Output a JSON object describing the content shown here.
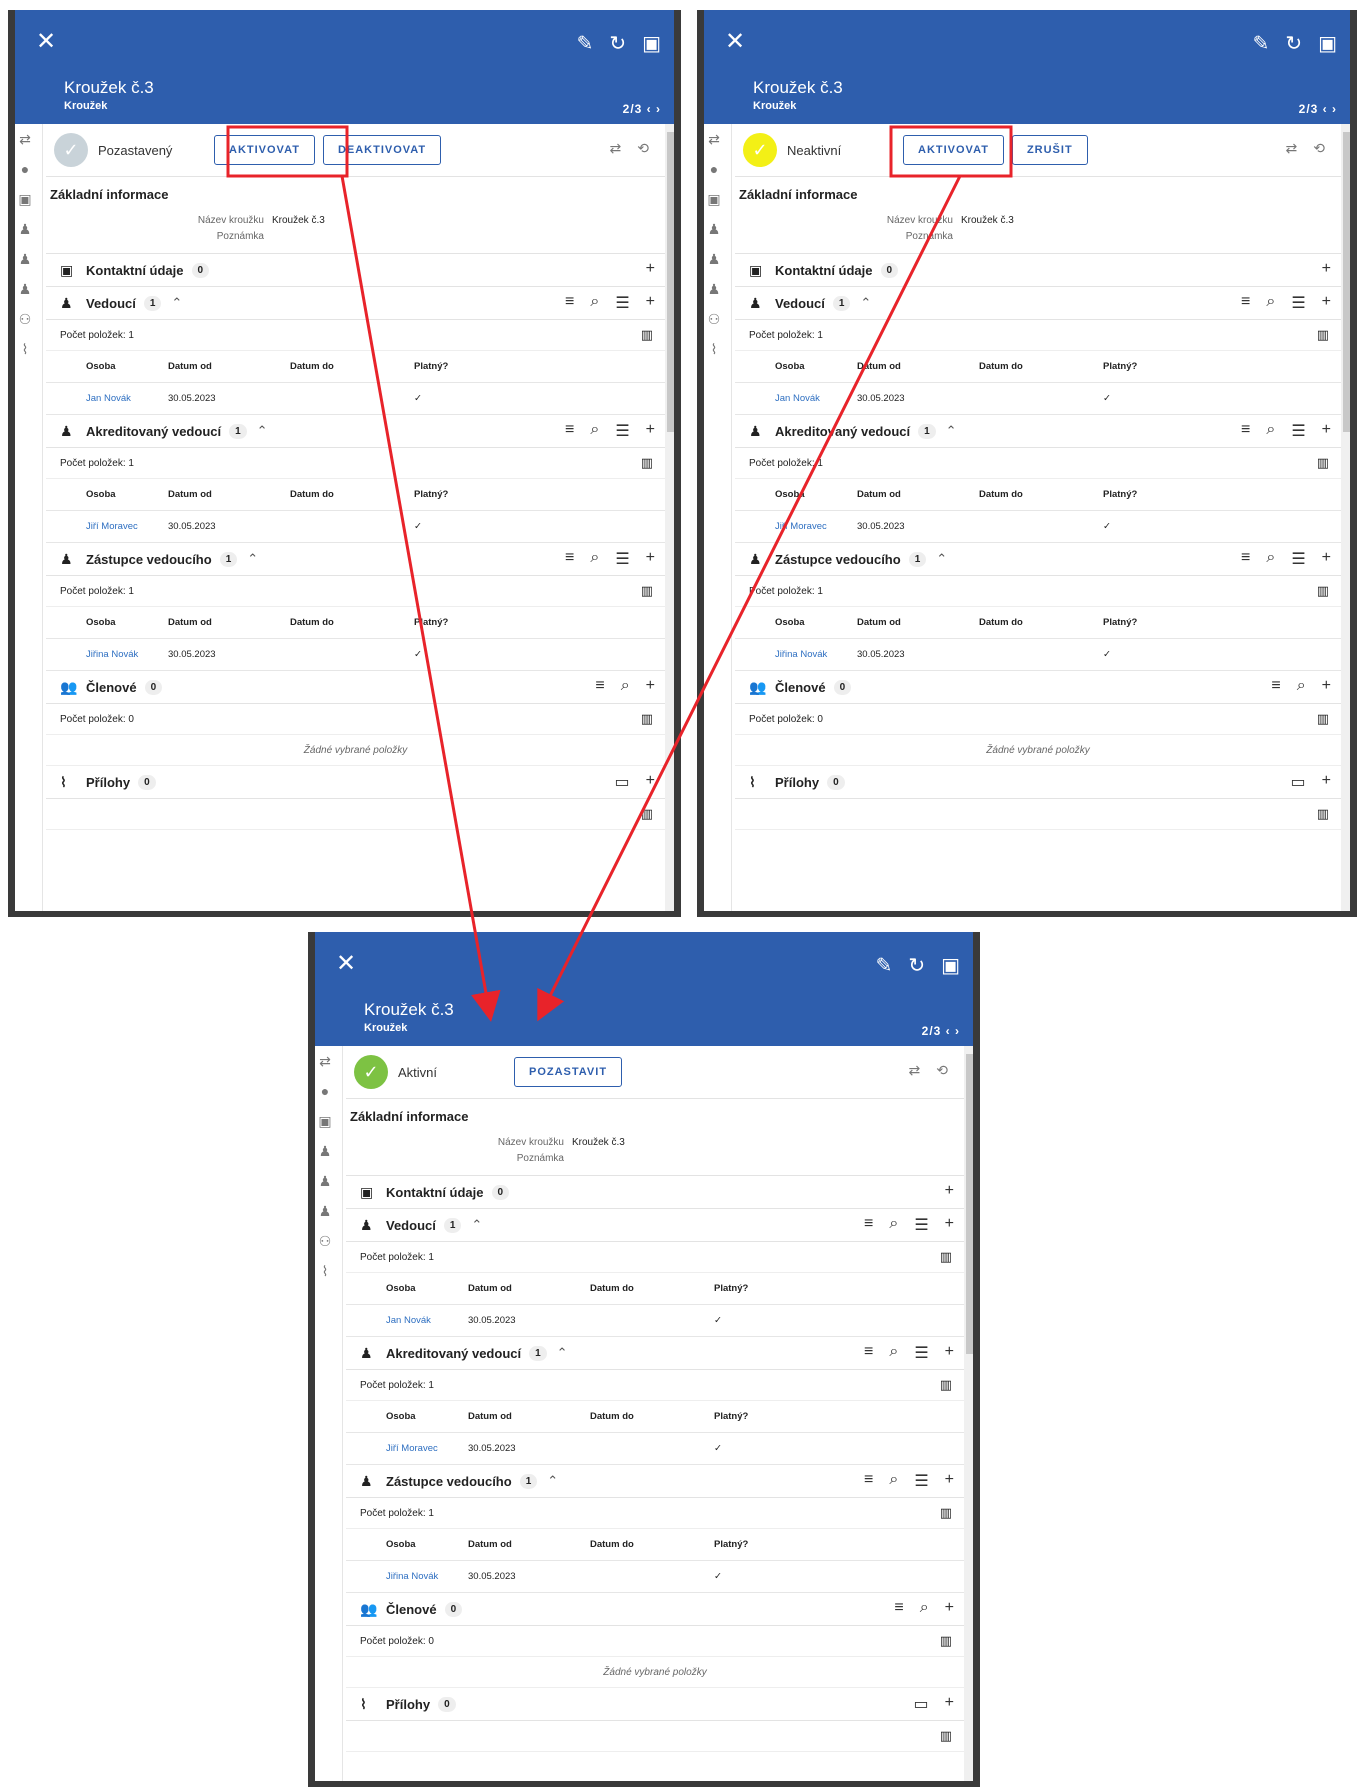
{
  "panels": [
    {
      "key": "paused",
      "header": {
        "title": "Kroužek č.3",
        "subtitle": "Kroužek",
        "pager": "2/3  ‹  ›"
      },
      "status": {
        "label": "Pozastavený",
        "color": "#c9d3d9",
        "buttons": [
          "AKTIVOVAT",
          "DEAKTIVOVAT"
        ]
      }
    },
    {
      "key": "inactive",
      "header": {
        "title": "Kroužek č.3",
        "subtitle": "Kroužek",
        "pager": "2/3  ‹  ›"
      },
      "status": {
        "label": "Neaktivní",
        "color": "#f3f016",
        "buttons": [
          "AKTIVOVAT",
          "ZRUŠIT"
        ]
      }
    },
    {
      "key": "active",
      "header": {
        "title": "Kroužek č.3",
        "subtitle": "Kroužek",
        "pager": "2/3  ‹  ›"
      },
      "status": {
        "label": "Aktivní",
        "color": "#7dc243",
        "buttons": [
          "POZASTAVIT"
        ]
      }
    }
  ],
  "basic": {
    "heading": "Základní informace",
    "name_label": "Název kroužku",
    "name_value": "Kroužek č.3",
    "note_label": "Poznámka"
  },
  "sections": {
    "contacts": {
      "label": "Kontaktní údaje",
      "count": "0"
    },
    "members": {
      "label": "Členové",
      "count": "0",
      "items": "Počet položek: 0",
      "empty": "Žádné vybrané položky"
    },
    "attachments": {
      "label": "Přílohy",
      "count": "0"
    }
  },
  "tables": [
    {
      "label": "Vedoucí",
      "count": "1",
      "items": "Počet položek: 1",
      "person": "Jan Novák",
      "from": "30.05.2023",
      "valid": "✓"
    },
    {
      "label": "Akreditovaný vedoucí",
      "count": "1",
      "items": "Počet položek: 1",
      "person": "Jiří Moravec",
      "from": "30.05.2023",
      "valid": "✓"
    },
    {
      "label": "Zástupce vedoucího",
      "count": "1",
      "items": "Počet položek: 1",
      "person": "Jiřina Novák",
      "from": "30.05.2023",
      "valid": "✓"
    }
  ],
  "columns": [
    "Osoba",
    "Datum od",
    "Datum do",
    "Platný?"
  ],
  "colors": {
    "header": "#2e5ead",
    "highlight": "#e8232a"
  }
}
